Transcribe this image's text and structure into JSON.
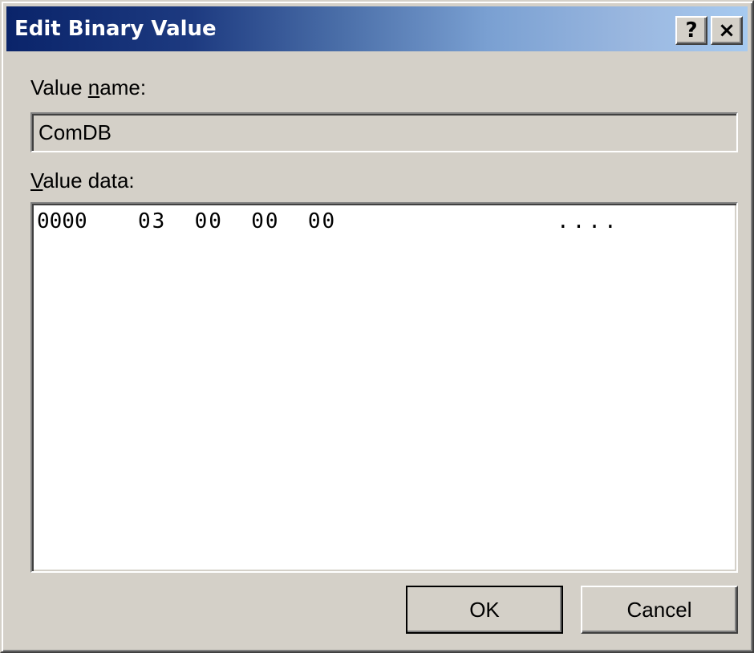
{
  "window": {
    "title": "Edit Binary Value",
    "help_label": "?",
    "close_label": "×"
  },
  "fields": {
    "value_name": {
      "label_accel": "n",
      "label_pre": "Value ",
      "label_post": "ame:",
      "value": "ComDB"
    },
    "value_data": {
      "label_accel": "V",
      "label_post": "alue data:",
      "rows": [
        {
          "offset": "0000",
          "bytes": "03  00  00  00",
          "ascii": "...."
        }
      ]
    }
  },
  "buttons": {
    "ok_label": "OK",
    "cancel_label": "Cancel"
  },
  "colors": {
    "title_gradient_start": "#0a246a",
    "title_gradient_end": "#a6caf0",
    "face": "#d4d0c8"
  }
}
